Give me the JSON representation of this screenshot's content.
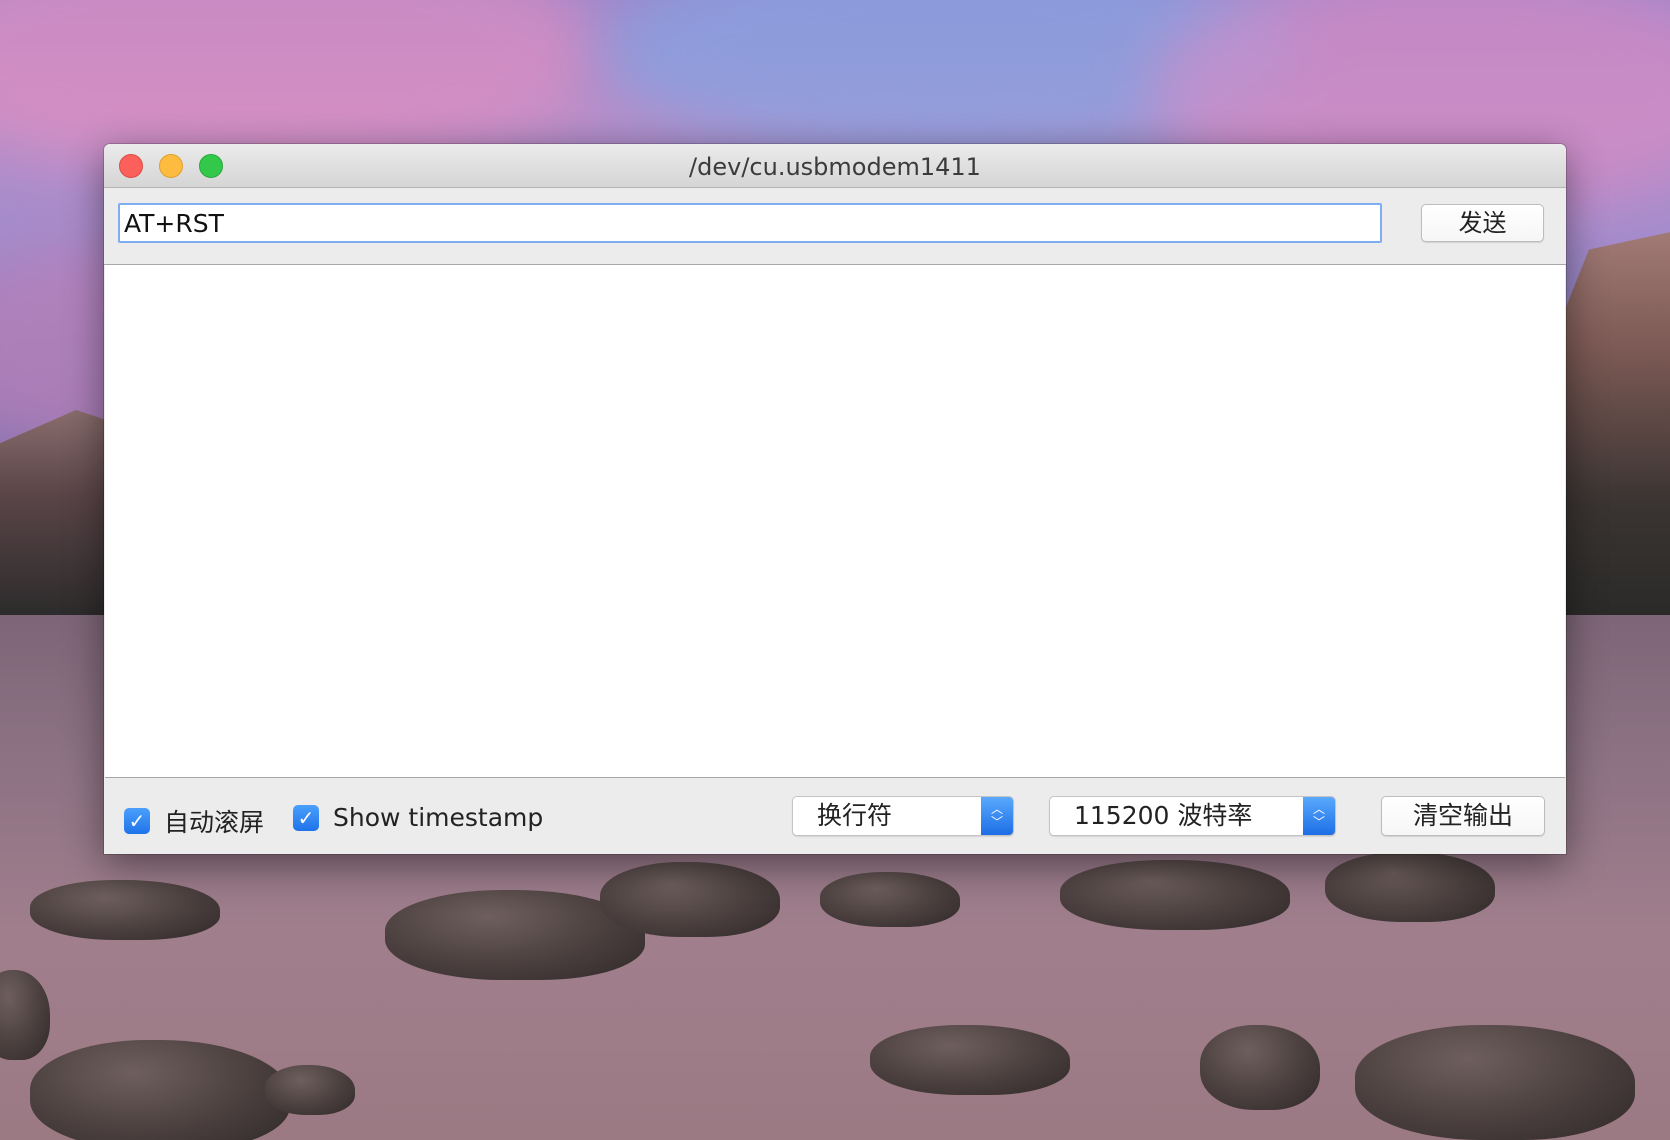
{
  "window": {
    "title": "/dev/cu.usbmodem1411"
  },
  "send_row": {
    "input_value": "AT+RST",
    "send_label": "发送"
  },
  "output": {
    "lines": []
  },
  "bottom_bar": {
    "autoscroll": {
      "label": "自动滚屏",
      "checked": true
    },
    "timestamp": {
      "label": "Show timestamp",
      "checked": true
    },
    "line_ending": {
      "selected": "换行符"
    },
    "baud_rate": {
      "selected": "115200 波特率"
    },
    "clear_label": "清空输出"
  },
  "colors": {
    "accent": "#1f73ea",
    "focus_ring": "#7eaef0",
    "close": "#fc605b",
    "minimize": "#fdbc40",
    "maximize": "#34c84a"
  }
}
